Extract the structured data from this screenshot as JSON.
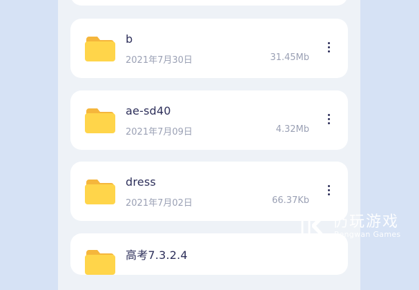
{
  "files": [
    {
      "name": "",
      "date": "",
      "size": ""
    },
    {
      "name": "b",
      "date": "2021年7月30日",
      "size": "31.45Mb"
    },
    {
      "name": "ae-sd40",
      "date": "2021年7月09日",
      "size": "4.32Mb"
    },
    {
      "name": "dress",
      "date": "2021年7月02日",
      "size": "66.37Kb"
    },
    {
      "name": "高考7.3.2.4",
      "date": "",
      "size": ""
    }
  ],
  "icons": {
    "folder": "folder-icon",
    "more": "more-vertical-icon"
  },
  "colors": {
    "background": "#d6e2f5",
    "panel": "#eef2f7",
    "card": "#ffffff",
    "folder_body": "#ffd54a",
    "folder_tab": "#f5b63c",
    "title_text": "#2d2f5a",
    "meta_text": "#9aa0b4"
  },
  "watermark": {
    "title": "仍玩游戏",
    "subtitle": "Rengwan Games"
  }
}
